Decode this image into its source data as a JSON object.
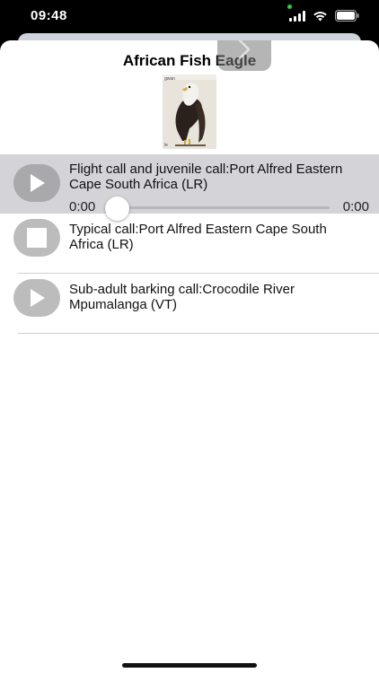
{
  "status_bar": {
    "time": "09:48"
  },
  "sheet": {
    "title": "African Fish Eagle"
  },
  "image": {
    "caption_top": "gwan",
    "caption_bottom": "le"
  },
  "calls": [
    {
      "label": "Flight call and juvenile call:Port Alfred  Eastern Cape  South Africa (LR)",
      "state": "selected",
      "elapsed": "0:00",
      "duration": "0:00",
      "progress": 0
    },
    {
      "label": "Typical call:Port Alfred  Eastern Cape  South Africa (LR)",
      "state": "playing"
    },
    {
      "label": "Sub-adult barking call:Crocodile River  Mpumalanga (VT)",
      "state": "idle"
    }
  ],
  "colors": {
    "selected_row": "#d3d3d8",
    "button": "#bcbcbc"
  },
  "icons": [
    "signal-icon",
    "wifi-icon",
    "battery-icon",
    "chevron-right-icon",
    "play-icon",
    "stop-icon"
  ]
}
